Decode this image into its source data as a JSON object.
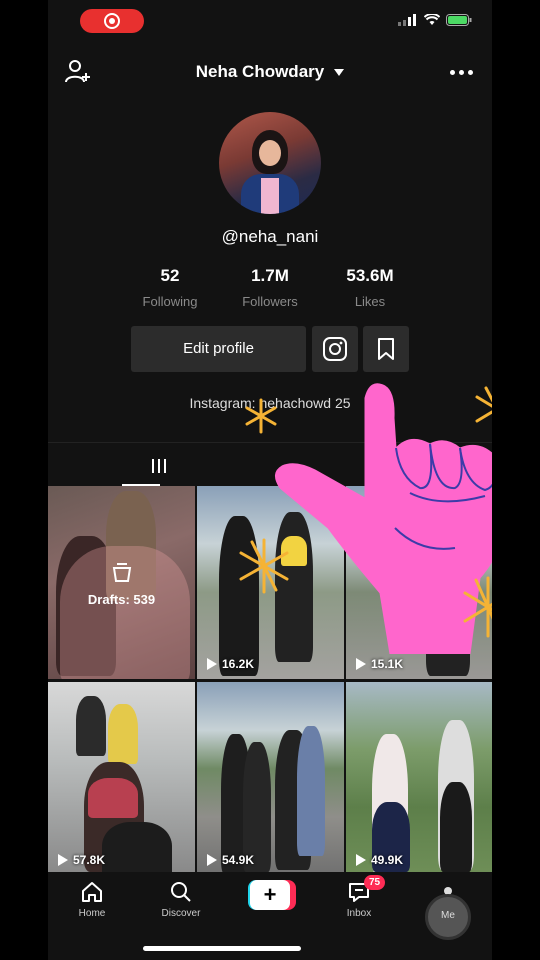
{
  "status": {
    "recording": true
  },
  "header": {
    "title": "Neha Chowdary",
    "add_user_icon": "add-user-icon",
    "more_icon": "more-icon"
  },
  "profile": {
    "username": "@neha_nani",
    "stats": [
      {
        "value": "52",
        "label": "Following"
      },
      {
        "value": "1.7M",
        "label": "Followers"
      },
      {
        "value": "53.6M",
        "label": "Likes"
      }
    ],
    "edit_button": "Edit profile",
    "bio": "Instagram: nehachowd    25"
  },
  "tabs": [
    {
      "icon": "grid-icon"
    },
    {
      "icon": "liked-icon"
    }
  ],
  "videos": [
    {
      "type": "drafts",
      "label": "Drafts: 539"
    },
    {
      "views": "16.2K"
    },
    {
      "views": "15.1K"
    },
    {
      "views": "57.8K"
    },
    {
      "views": "54.9K"
    },
    {
      "views": "49.9K"
    }
  ],
  "bottom_nav": {
    "home": "Home",
    "discover": "Discover",
    "create": "+",
    "inbox": "Inbox",
    "inbox_badge": "75",
    "me": "Me"
  },
  "colors": {
    "accent": "#fe2c55",
    "cyan": "#20d5ec",
    "sticker_pink": "#ff66cc",
    "sparkle": "#f5b335"
  }
}
